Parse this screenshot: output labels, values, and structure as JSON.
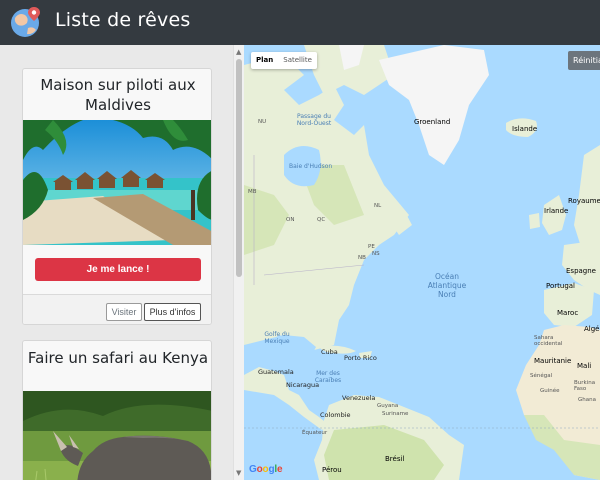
{
  "header": {
    "title": "Liste de rêves",
    "logo": "globe-pin-logo",
    "background_color": "#343a40"
  },
  "dreams": [
    {
      "title": "Maison sur piloti aux Maldives",
      "image": "maldives-overwater-villas-photo",
      "cta_label": "Je me lance !",
      "visit_label": "Visiter",
      "info_label": "Plus d'infos"
    },
    {
      "title": "Faire un safari au Kenya",
      "image": "rhinoceros-savanna-photo"
    }
  ],
  "map": {
    "type_controls": {
      "plan": "Plan",
      "satellite": "Satellite",
      "active": "Plan"
    },
    "reset_label": "Réinitia",
    "labels": {
      "groenland": "Groenland",
      "islande": "Islande",
      "irlande": "Irlande",
      "royaume_uni": "Royaume-Uni",
      "espagne": "Espagne",
      "portugal": "Portugal",
      "maroc": "Maroc",
      "algerie": "Algéri",
      "sahara": "Sahara occidental",
      "mauritanie": "Mauritanie",
      "mali": "Mali",
      "senegal": "Sénégal",
      "burkina": "Burkina Faso",
      "guinee": "Guinée",
      "ghana": "Ghana",
      "cuba": "Cuba",
      "porto_rico": "Porto Rico",
      "guatemala": "Guatemala",
      "nicaragua": "Nicaragua",
      "venezuela": "Venezuela",
      "colombie": "Colombie",
      "guyana": "Guyana",
      "suriname": "Suriname",
      "equateur": "Équateur",
      "perou": "Pérou",
      "bresil": "Brésil",
      "ocean": "Océan Atlantique Nord",
      "hudson": "Baie d'Hudson",
      "golfe": "Golfe du Mexique",
      "caraibes": "Mer des Caraïbes",
      "nord_ouest": "Passage du Nord-Ouest",
      "nu": "NU",
      "mb": "MB",
      "on": "ON",
      "qc": "QC",
      "nl": "NL",
      "pe": "PE",
      "ns": "NS",
      "nb": "NB"
    },
    "google": [
      "G",
      "o",
      "o",
      "g",
      "l",
      "e"
    ]
  },
  "colors": {
    "cta": "#dc3545",
    "water": "#aadaff",
    "land": "#e8efd8",
    "ice": "#f5f5f5"
  }
}
